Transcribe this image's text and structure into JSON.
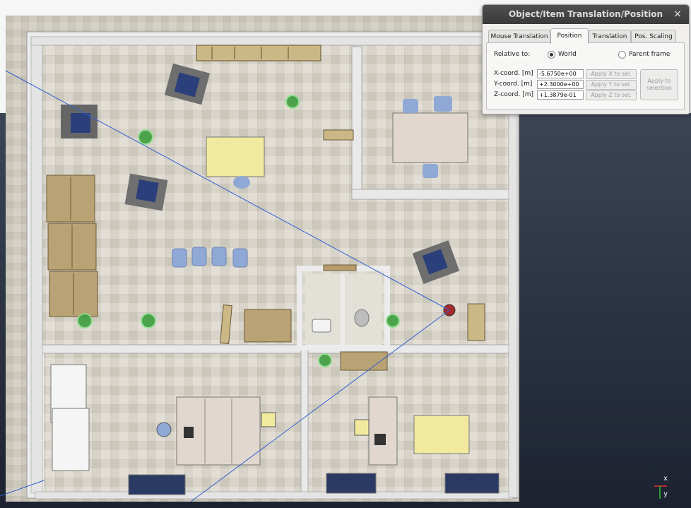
{
  "dialog": {
    "title": "Object/Item Translation/Position",
    "close_icon": "×",
    "tabs": [
      {
        "label": "Mouse Translation",
        "active": false
      },
      {
        "label": "Position",
        "active": true
      },
      {
        "label": "Translation",
        "active": false
      },
      {
        "label": "Pos. Scaling",
        "active": false
      }
    ],
    "relative_to_label": "Relative to:",
    "relative_options": [
      {
        "label": "World",
        "selected": true
      },
      {
        "label": "Parent frame",
        "selected": false
      }
    ],
    "coords": [
      {
        "label": "X-coord. [m]",
        "value": "-5.6750e+00",
        "button": "Apply X to sel."
      },
      {
        "label": "Y-coord. [m]",
        "value": "+2.3000e+00",
        "button": "Apply Y to sel."
      },
      {
        "label": "Z-coord. [m]",
        "value": "+1.3879e-01",
        "button": "Apply Z to sel."
      }
    ],
    "apply_selection": "Apply to\nselection"
  },
  "axes": {
    "x_label": "x",
    "y_label": "y",
    "x_color": "#e03030",
    "y_color": "#30c030"
  },
  "scene": {
    "floor_color": "#c9c5b8",
    "wall_color": "#e8e8e8",
    "ground_color": "#2c3340",
    "ray_color": "#2f5fd0"
  }
}
